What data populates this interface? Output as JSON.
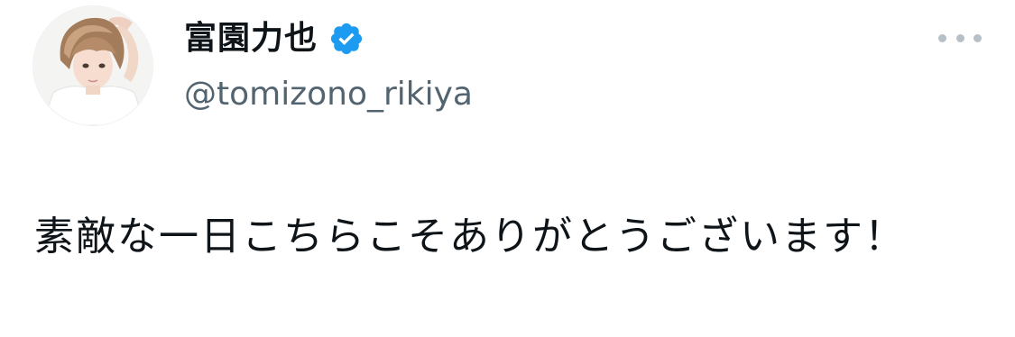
{
  "tweet": {
    "author": {
      "display_name": "富園力也",
      "handle": "@tomizono_rikiya",
      "verified": true,
      "verified_color": "#1d9bf0"
    },
    "more_menu_icon": "more-horizontal-icon",
    "text": "素敵な一日こちらこそありがとうございます！"
  }
}
